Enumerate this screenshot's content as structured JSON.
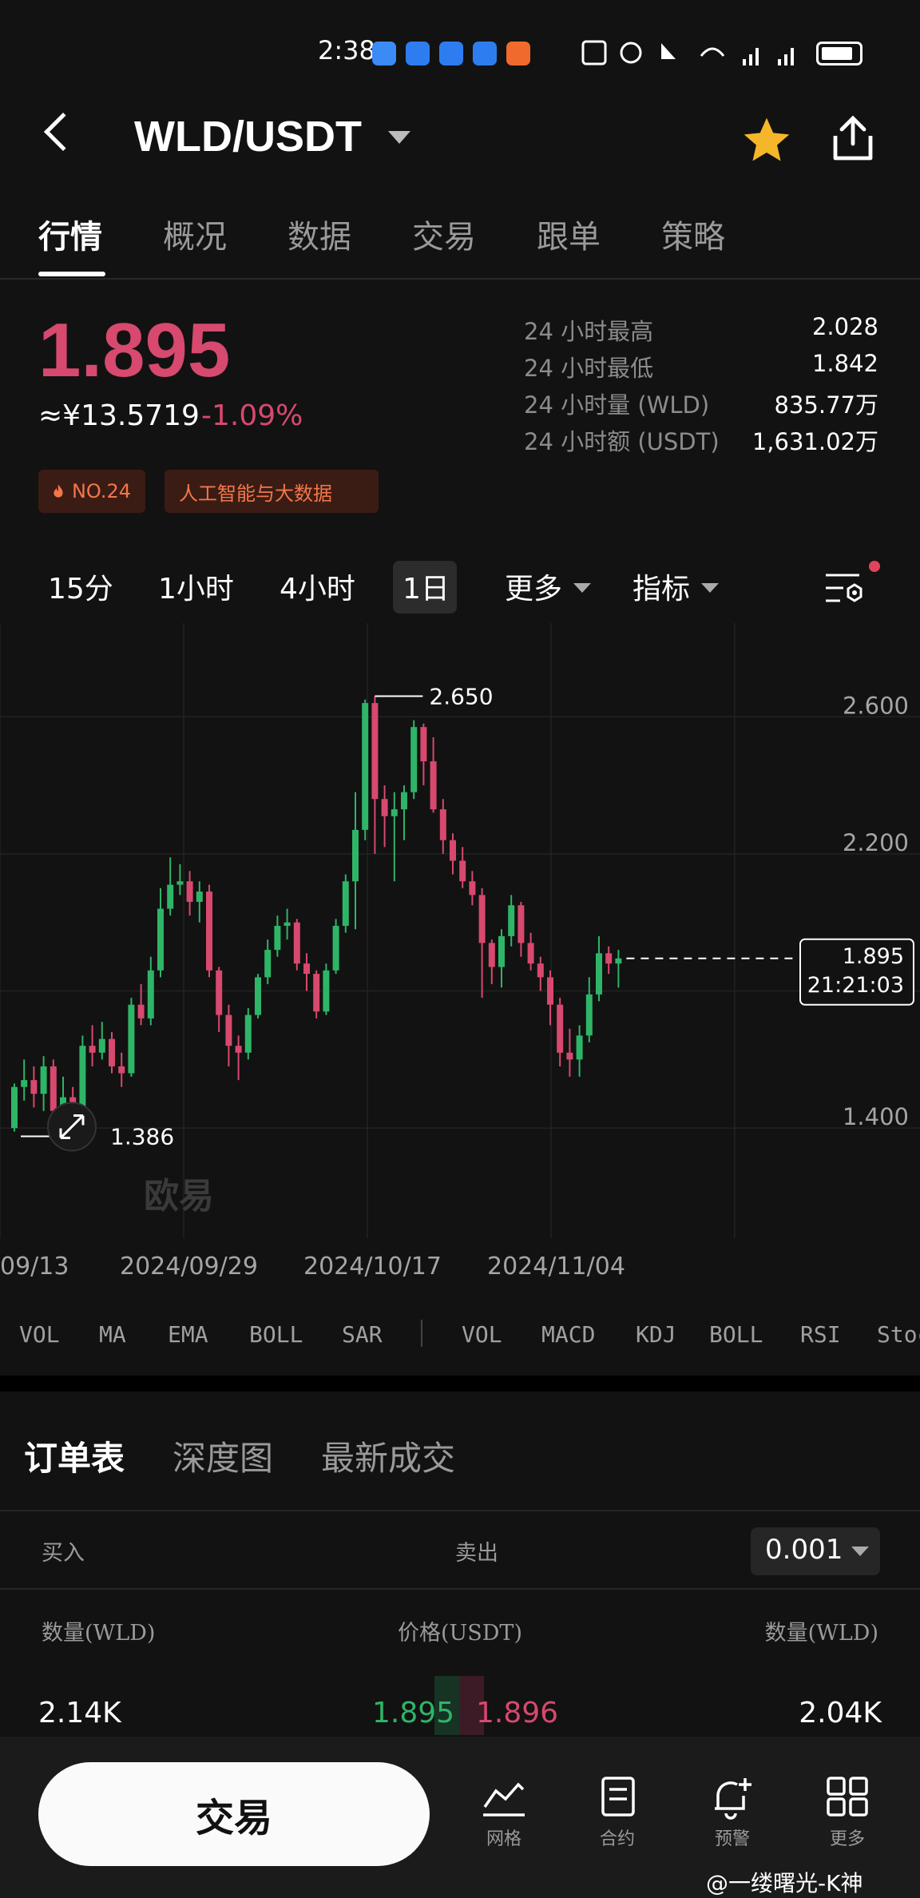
{
  "status_bar": {
    "time": "2:38",
    "network": "5G 4G",
    "apps": [
      {
        "color": "#3b8bf6"
      },
      {
        "color": "#2d7df0"
      },
      {
        "color": "#2d7df0"
      },
      {
        "color": "#2d7df0"
      },
      {
        "color": "#f06a2d"
      }
    ]
  },
  "header": {
    "title": "WLD/USDT"
  },
  "tabs": [
    "行情",
    "概况",
    "数据",
    "交易",
    "跟单",
    "策略"
  ],
  "price": {
    "last": "1.895",
    "cny": "≈¥13.5719",
    "change": "-1.09%",
    "rank_badge": "NO.24",
    "category_badge": "人工智能与大数据"
  },
  "stats": [
    {
      "label": "24 小时最高",
      "value": "2.028"
    },
    {
      "label": "24 小时最低",
      "value": "1.842"
    },
    {
      "label": "24 小时量 (WLD)",
      "value": "835.77万"
    },
    {
      "label": "24 小时额 (USDT)",
      "value": "1,631.02万"
    }
  ],
  "intervals": {
    "m15": "15分",
    "h1": "1小时",
    "h4": "4小时",
    "d1": "1日",
    "more": "更多",
    "indicator": "指标"
  },
  "chart_data": {
    "type": "candlestick",
    "y_ticks": [
      "2.600",
      "2.200",
      "1.400"
    ],
    "ylim": [
      1.2,
      2.85
    ],
    "x_labels": [
      "09/13",
      "2024/09/29",
      "2024/10/17",
      "2024/11/04"
    ],
    "high_marker": "2.650",
    "low_marker": "1.386",
    "current_price": "1.895",
    "countdown": "21:21:03",
    "watermark": "欧易",
    "colors": {
      "up": "#2eb567",
      "down": "#d7496e"
    },
    "candles": [
      [
        1.4,
        1.52,
        1.53,
        1.39
      ],
      [
        1.52,
        1.54,
        1.6,
        1.48
      ],
      [
        1.54,
        1.5,
        1.58,
        1.46
      ],
      [
        1.5,
        1.58,
        1.61,
        1.45
      ],
      [
        1.58,
        1.45,
        1.6,
        1.4
      ],
      [
        1.45,
        1.49,
        1.55,
        1.42
      ],
      [
        1.49,
        1.46,
        1.52,
        1.41
      ],
      [
        1.46,
        1.64,
        1.67,
        1.45
      ],
      [
        1.64,
        1.62,
        1.7,
        1.58
      ],
      [
        1.62,
        1.66,
        1.71,
        1.6
      ],
      [
        1.66,
        1.58,
        1.68,
        1.56
      ],
      [
        1.58,
        1.56,
        1.62,
        1.52
      ],
      [
        1.56,
        1.76,
        1.78,
        1.55
      ],
      [
        1.76,
        1.72,
        1.82,
        1.7
      ],
      [
        1.72,
        1.86,
        1.9,
        1.7
      ],
      [
        1.86,
        2.04,
        2.1,
        1.84
      ],
      [
        2.04,
        2.11,
        2.19,
        2.02
      ],
      [
        2.11,
        2.12,
        2.17,
        2.08
      ],
      [
        2.12,
        2.06,
        2.15,
        2.02
      ],
      [
        2.06,
        2.09,
        2.12,
        2.0
      ],
      [
        2.09,
        1.86,
        2.11,
        1.84
      ],
      [
        1.86,
        1.73,
        1.87,
        1.68
      ],
      [
        1.73,
        1.64,
        1.76,
        1.58
      ],
      [
        1.64,
        1.62,
        1.67,
        1.54
      ],
      [
        1.62,
        1.73,
        1.75,
        1.6
      ],
      [
        1.73,
        1.84,
        1.85,
        1.72
      ],
      [
        1.84,
        1.92,
        1.95,
        1.82
      ],
      [
        1.92,
        1.99,
        2.02,
        1.9
      ],
      [
        1.99,
        2.0,
        2.04,
        1.95
      ],
      [
        2.0,
        1.88,
        2.01,
        1.86
      ],
      [
        1.88,
        1.85,
        1.91,
        1.8
      ],
      [
        1.85,
        1.74,
        1.86,
        1.72
      ],
      [
        1.74,
        1.86,
        1.88,
        1.73
      ],
      [
        1.86,
        1.99,
        2.01,
        1.85
      ],
      [
        1.99,
        2.12,
        2.14,
        1.97
      ],
      [
        2.12,
        2.27,
        2.38,
        1.98
      ],
      [
        2.27,
        2.64,
        2.65,
        2.24
      ],
      [
        2.64,
        2.36,
        2.66,
        2.2
      ],
      [
        2.36,
        2.31,
        2.4,
        2.22
      ],
      [
        2.31,
        2.33,
        2.38,
        2.12
      ],
      [
        2.33,
        2.38,
        2.4,
        2.24
      ],
      [
        2.38,
        2.57,
        2.59,
        2.36
      ],
      [
        2.57,
        2.47,
        2.58,
        2.4
      ],
      [
        2.47,
        2.33,
        2.54,
        2.32
      ],
      [
        2.33,
        2.24,
        2.36,
        2.2
      ],
      [
        2.24,
        2.18,
        2.26,
        2.14
      ],
      [
        2.18,
        2.12,
        2.22,
        2.1
      ],
      [
        2.12,
        2.08,
        2.15,
        2.05
      ],
      [
        2.08,
        1.94,
        2.1,
        1.78
      ],
      [
        1.94,
        1.87,
        1.95,
        1.82
      ],
      [
        1.87,
        1.96,
        1.98,
        1.81
      ],
      [
        1.96,
        2.05,
        2.08,
        1.93
      ],
      [
        2.05,
        1.94,
        2.06,
        1.9
      ],
      [
        1.94,
        1.88,
        1.97,
        1.86
      ],
      [
        1.88,
        1.84,
        1.9,
        1.8
      ],
      [
        1.84,
        1.76,
        1.86,
        1.7
      ],
      [
        1.76,
        1.62,
        1.78,
        1.58
      ],
      [
        1.62,
        1.6,
        1.69,
        1.55
      ],
      [
        1.6,
        1.67,
        1.7,
        1.55
      ],
      [
        1.67,
        1.79,
        1.84,
        1.65
      ],
      [
        1.79,
        1.91,
        1.96,
        1.77
      ],
      [
        1.91,
        1.88,
        1.93,
        1.85
      ],
      [
        1.88,
        1.895,
        1.92,
        1.81
      ]
    ]
  },
  "indicators_main": [
    "VOL",
    "MA",
    "EMA",
    "BOLL",
    "SAR"
  ],
  "indicators_sub": [
    "VOL",
    "MACD",
    "KDJ",
    "BOLL",
    "RSI",
    "Stoc"
  ],
  "orderbook": {
    "tabs": [
      "订单表",
      "深度图",
      "最新成交"
    ],
    "buy_label": "买入",
    "sell_label": "卖出",
    "precision": "0.001",
    "col_qty_left": "数量(WLD)",
    "col_price": "价格(USDT)",
    "col_qty_right": "数量(WLD)",
    "row": {
      "bid_qty": "2.14K",
      "bid_price": "1.895",
      "ask_price": "1.896",
      "ask_qty": "2.04K"
    }
  },
  "bottom_nav": {
    "trade": "交易",
    "items": [
      "网格",
      "合约",
      "预警",
      "更多"
    ]
  },
  "watermark": "@一缕曙光-K神"
}
